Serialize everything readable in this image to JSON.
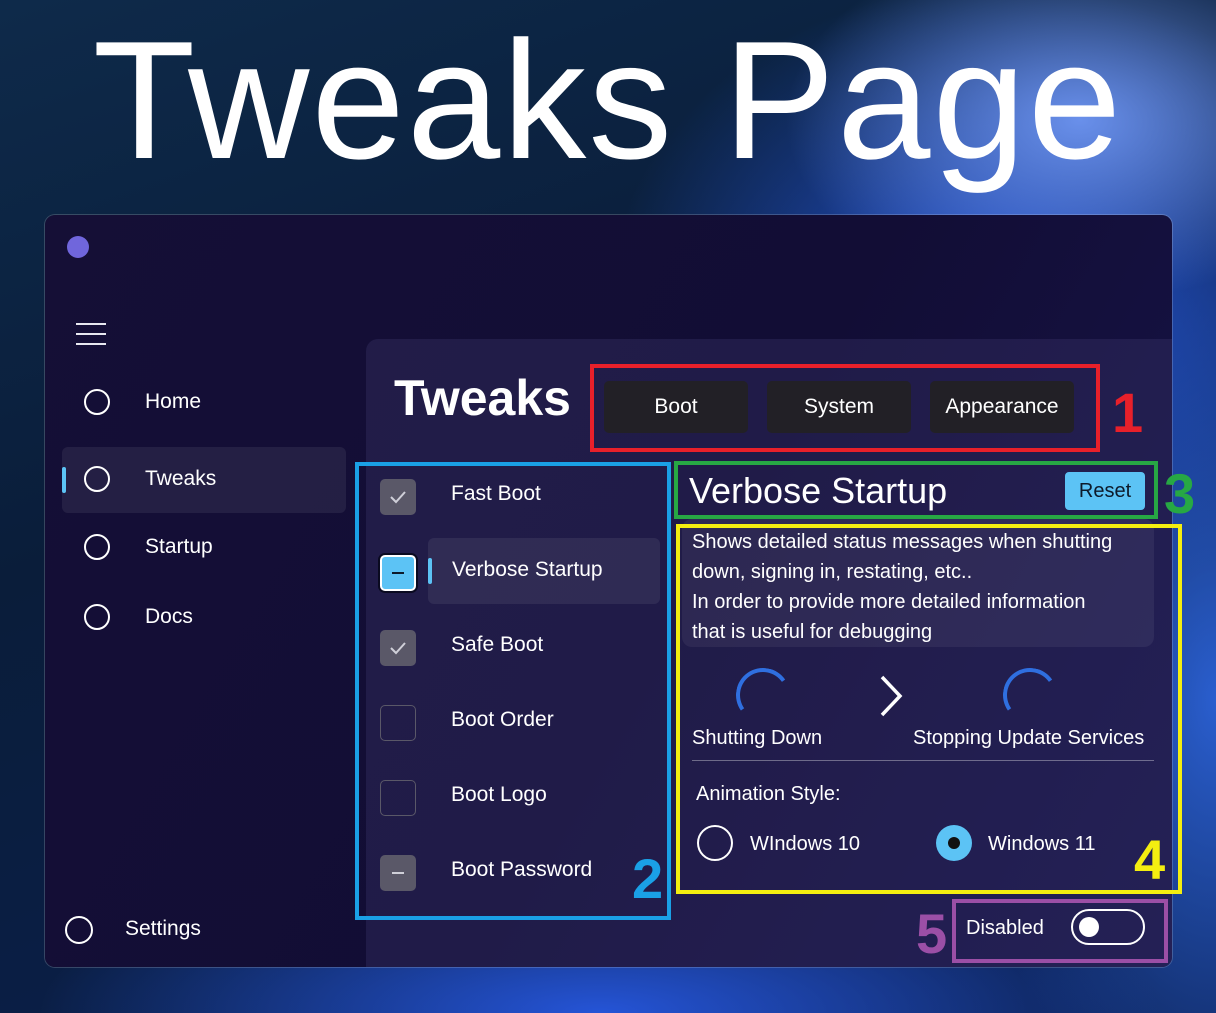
{
  "headline": "Tweaks Page",
  "sidebar": {
    "items": [
      {
        "label": "Home"
      },
      {
        "label": "Tweaks",
        "active": true
      },
      {
        "label": "Startup"
      },
      {
        "label": "Docs"
      }
    ],
    "settings_label": "Settings"
  },
  "page": {
    "title": "Tweaks",
    "tabs": [
      {
        "label": "Boot"
      },
      {
        "label": "System"
      },
      {
        "label": "Appearance"
      }
    ]
  },
  "tweaks": [
    {
      "label": "Fast Boot",
      "state": "checked"
    },
    {
      "label": "Verbose Startup",
      "state": "indeterminate",
      "selected": true
    },
    {
      "label": "Safe Boot",
      "state": "checked"
    },
    {
      "label": "Boot Order",
      "state": "unchecked"
    },
    {
      "label": "Boot Logo",
      "state": "unchecked"
    },
    {
      "label": "Boot Password",
      "state": "indeterminate"
    }
  ],
  "detail": {
    "title": "Verbose Startup",
    "reset_label": "Reset",
    "description_lines": [
      "Shows detailed status messages when shutting",
      "down, signing in, restating, etc..",
      "In order to provide more detailed information",
      "that is useful for debugging"
    ],
    "stage_from": "Shutting Down",
    "stage_to": "Stopping Update Services",
    "animation_style_label": "Animation Style:",
    "options": [
      {
        "label": "WIndows 10",
        "selected": false
      },
      {
        "label": "Windows 11",
        "selected": true
      }
    ],
    "toggle_label": "Disabled",
    "toggle_on": false
  },
  "annotations": [
    "1",
    "2",
    "3",
    "4",
    "5"
  ],
  "colors": {
    "accent": "#5cc3f5",
    "annot_1": "#e8202a",
    "annot_2": "#1aa0e6",
    "annot_3": "#27a844",
    "annot_4": "#f4ee10",
    "annot_5": "#9b4fa6"
  }
}
